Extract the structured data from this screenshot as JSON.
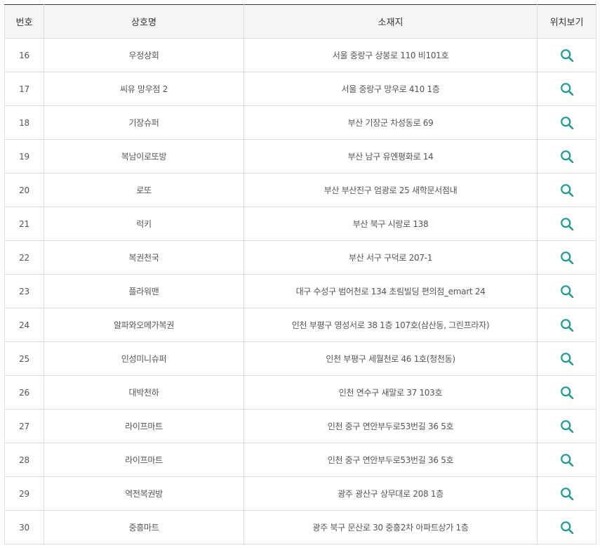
{
  "table": {
    "headers": {
      "number": "번호",
      "store_name": "상호명",
      "location": "소재지",
      "view_location": "위치보기"
    },
    "icon": "search-icon",
    "icon_color": "#1a9e94",
    "rows": [
      {
        "number": "16",
        "store_name": "우정상회",
        "location": "서울 중랑구 상봉로 110 비101호"
      },
      {
        "number": "17",
        "store_name": "씨유 망우점 2",
        "location": "서울 중랑구 망우로 410 1층"
      },
      {
        "number": "18",
        "store_name": "기장슈퍼",
        "location": "부산 기장군 차성동로 69"
      },
      {
        "number": "19",
        "store_name": "복남이로또방",
        "location": "부산 남구 유엔평화로 14"
      },
      {
        "number": "20",
        "store_name": "로또",
        "location": "부산 부산진구 엄광로 25 새학문서점내"
      },
      {
        "number": "21",
        "store_name": "럭키",
        "location": "부산 북구 시랑로 138"
      },
      {
        "number": "22",
        "store_name": "복권천국",
        "location": "부산 서구 구덕로 207-1"
      },
      {
        "number": "23",
        "store_name": "플라워맨",
        "location": "대구 수성구 범어천로 134 초림빌딩 편의점_emart 24"
      },
      {
        "number": "24",
        "store_name": "알파와오메가복권",
        "location": "인천 부평구 영성서로 38 1층 107호(삼산동, 그린프라자)"
      },
      {
        "number": "25",
        "store_name": "인성미니슈퍼",
        "location": "인천 부평구 세월천로 46 1호(청천동)"
      },
      {
        "number": "26",
        "store_name": "대박천하",
        "location": "인천 연수구 새말로 37 103호"
      },
      {
        "number": "27",
        "store_name": "라이프마트",
        "location": "인천 중구 연안부두로53번길 36 5호"
      },
      {
        "number": "28",
        "store_name": "라이프마트",
        "location": "인천 중구 연안부두로53번길 36 5호"
      },
      {
        "number": "29",
        "store_name": "역전복권방",
        "location": "광주 광산구 상무대로 208 1층"
      },
      {
        "number": "30",
        "store_name": "중흥마트",
        "location": "광주 북구 문산로 30 중흥2차 아파트상가 1층"
      }
    ]
  }
}
